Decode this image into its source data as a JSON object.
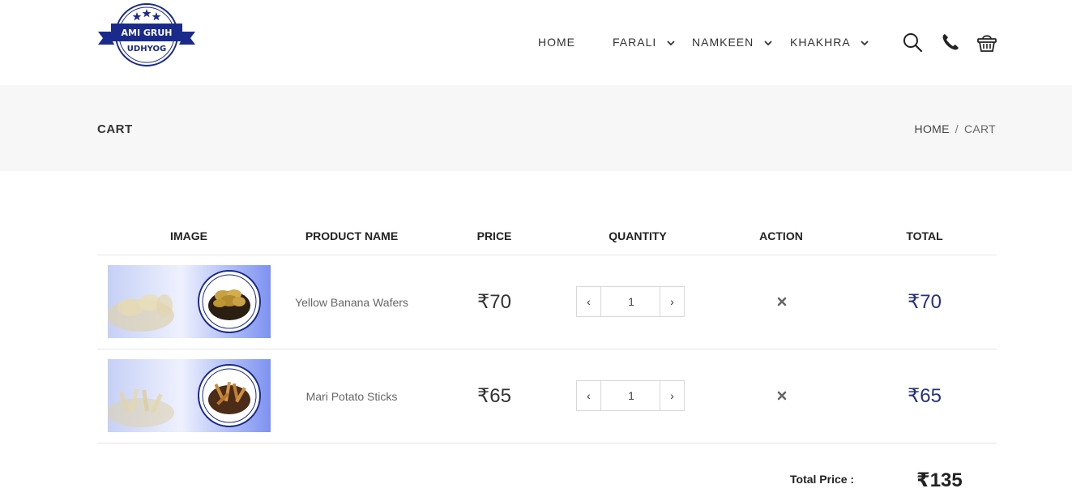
{
  "brand": {
    "line1": "AMI GRUH",
    "line2": "UDHYOG",
    "color": "#1a2a8c"
  },
  "nav": {
    "items": [
      {
        "label": "HOME",
        "has_dropdown": false
      },
      {
        "label": "FARALI",
        "has_dropdown": true
      },
      {
        "label": "NAMKEEN",
        "has_dropdown": true
      },
      {
        "label": "KHAKHRA",
        "has_dropdown": true
      }
    ],
    "icons": [
      "search-icon",
      "phone-icon",
      "basket-icon"
    ]
  },
  "page": {
    "title": "CART",
    "breadcrumb": {
      "home": "HOME",
      "separator": "/",
      "current": "CART"
    }
  },
  "cart": {
    "columns": [
      "IMAGE",
      "PRODUCT NAME",
      "PRICE",
      "QUANTITY",
      "ACTION",
      "TOTAL"
    ],
    "rows": [
      {
        "name": "Yellow Banana Wafers",
        "price": "₹70",
        "quantity": "1",
        "total": "₹70"
      },
      {
        "name": "Mari Potato Sticks",
        "price": "₹65",
        "quantity": "1",
        "total": "₹65"
      }
    ],
    "qty_minus": "‹",
    "qty_plus": "›",
    "summary": {
      "label": "Total Price :",
      "value": "₹135"
    }
  },
  "colors": {
    "accent": "#27307f",
    "band": "#f7f7f7",
    "border": "#e6e6e6"
  }
}
